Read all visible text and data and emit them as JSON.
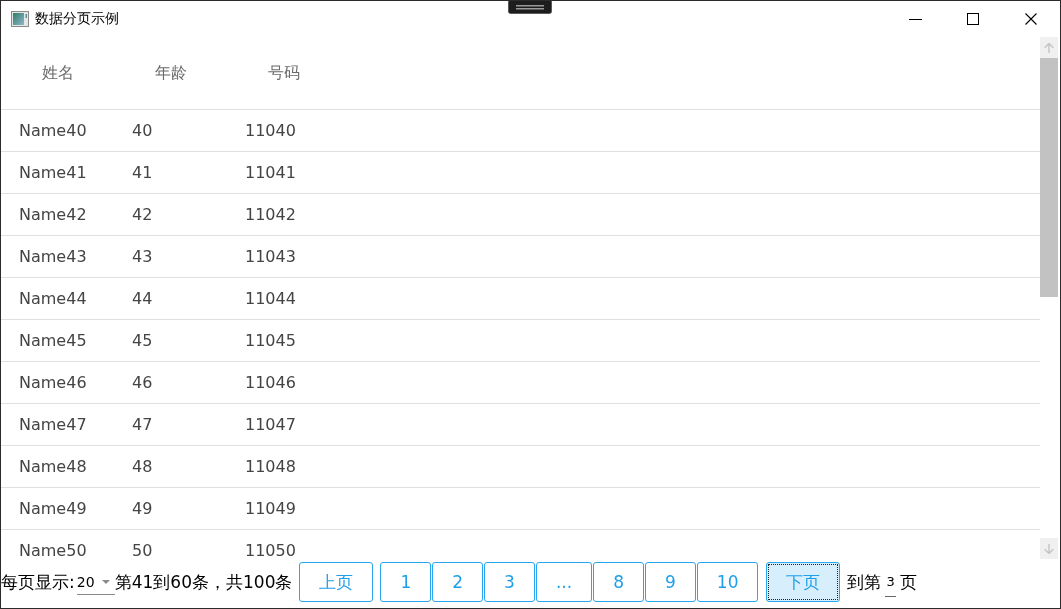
{
  "window": {
    "title": "数据分页示例"
  },
  "table": {
    "columns": [
      "姓名",
      "年龄",
      "号码"
    ],
    "rows": [
      [
        "Name40",
        "40",
        "11040"
      ],
      [
        "Name41",
        "41",
        "11041"
      ],
      [
        "Name42",
        "42",
        "11042"
      ],
      [
        "Name43",
        "43",
        "11043"
      ],
      [
        "Name44",
        "44",
        "11044"
      ],
      [
        "Name45",
        "45",
        "11045"
      ],
      [
        "Name46",
        "46",
        "11046"
      ],
      [
        "Name47",
        "47",
        "11047"
      ],
      [
        "Name48",
        "48",
        "11048"
      ],
      [
        "Name49",
        "49",
        "11049"
      ],
      [
        "Name50",
        "50",
        "11050"
      ]
    ]
  },
  "pager": {
    "page_size_label": "每页显示:",
    "page_size": "20",
    "summary": "第41到60条，共100条",
    "buttons": [
      {
        "kind": "nav",
        "label": "上页",
        "focused": false
      },
      {
        "kind": "page",
        "label": "1",
        "focused": false
      },
      {
        "kind": "page",
        "label": "2",
        "focused": false
      },
      {
        "kind": "page",
        "label": "3",
        "focused": false
      },
      {
        "kind": "more",
        "label": "...",
        "focused": false
      },
      {
        "kind": "page",
        "label": "8",
        "focused": false
      },
      {
        "kind": "page",
        "label": "9",
        "focused": false
      },
      {
        "kind": "page",
        "label": "10",
        "focused": false
      },
      {
        "kind": "nav",
        "label": "下页",
        "focused": true
      }
    ],
    "goto_label": "到第",
    "goto_page": "3",
    "goto_suffix": "页"
  }
}
